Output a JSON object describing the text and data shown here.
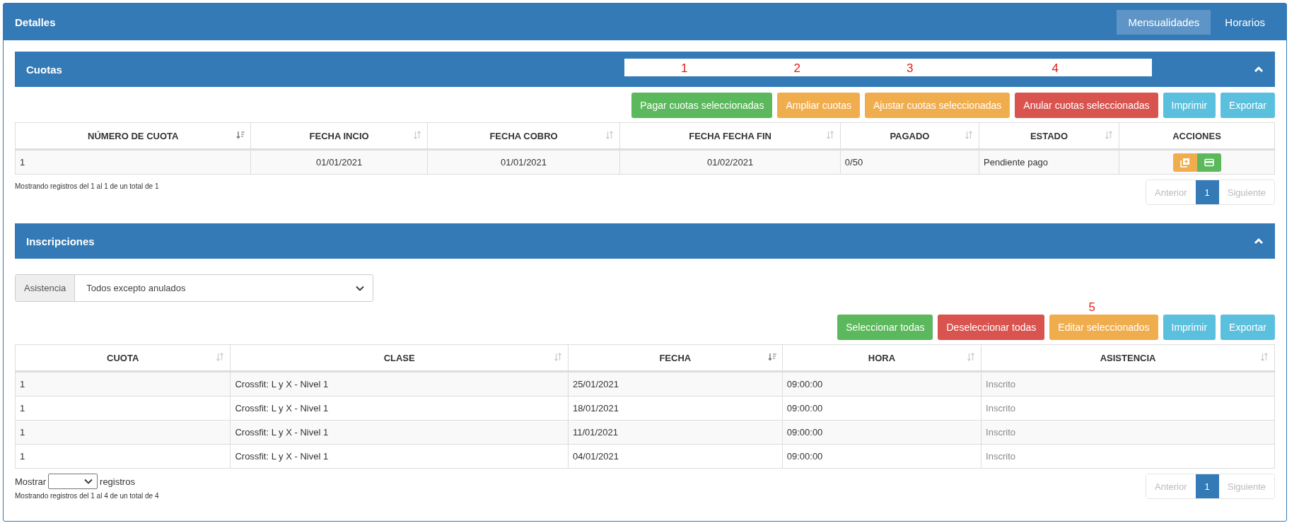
{
  "panel": {
    "title": "Detalles",
    "tabs": [
      {
        "label": "Mensualidades",
        "selected": true
      },
      {
        "label": "Horarios",
        "selected": false
      }
    ]
  },
  "cuotas": {
    "title": "Cuotas",
    "annotations": [
      "1",
      "2",
      "3",
      "4"
    ],
    "buttons": [
      {
        "label": "Pagar cuotas seleccionadas",
        "kind": "success"
      },
      {
        "label": "Ampliar cuotas",
        "kind": "warning"
      },
      {
        "label": "Ajustar cuotas seleccionadas",
        "kind": "warning"
      },
      {
        "label": "Anular cuotas seleccionadas",
        "kind": "danger"
      },
      {
        "label": "Imprimir",
        "kind": "info"
      },
      {
        "label": "Exportar",
        "kind": "info"
      }
    ],
    "columns": [
      {
        "label": "NÚMERO DE CUOTA",
        "sorted": true
      },
      {
        "label": "FECHA INCIO",
        "sorted": false
      },
      {
        "label": "FECHA COBRO",
        "sorted": false
      },
      {
        "label": "FECHA FECHA FIN",
        "sorted": false
      },
      {
        "label": "PAGADO",
        "sorted": false
      },
      {
        "label": "ESTADO",
        "sorted": false
      },
      {
        "label": "ACCIONES"
      }
    ],
    "rows": [
      {
        "cells": [
          "1",
          "01/01/2021",
          "01/01/2021",
          "01/02/2021",
          "0/50",
          "Pendiente pago"
        ],
        "actions": [
          {
            "kind": "add"
          },
          {
            "kind": "pay"
          }
        ]
      }
    ],
    "info": "Mostrando registros del 1 al 1 de un total de 1",
    "pagination": [
      {
        "label": "Anterior",
        "disabled": true,
        "selected": false
      },
      {
        "label": "1",
        "disabled": false,
        "selected": true
      },
      {
        "label": "Siguiente",
        "disabled": true,
        "selected": false
      }
    ]
  },
  "inscripciones": {
    "title": "Inscripciones",
    "filter": {
      "label": "Asistencia",
      "value": "Todos excepto anulados"
    },
    "annotation": "5",
    "buttons": [
      {
        "label": "Seleccionar todas",
        "kind": "success"
      },
      {
        "label": "Deseleccionar todas",
        "kind": "danger"
      },
      {
        "label": "Editar seleccionados",
        "kind": "warning"
      },
      {
        "label": "Imprimir",
        "kind": "info"
      },
      {
        "label": "Exportar",
        "kind": "info"
      }
    ],
    "columns": [
      {
        "label": "CUOTA",
        "sorted": false
      },
      {
        "label": "CLASE",
        "sorted": false
      },
      {
        "label": "FECHA",
        "sorted": true
      },
      {
        "label": "HORA",
        "sorted": false
      },
      {
        "label": "ASISTENCIA",
        "sorted": false
      }
    ],
    "rows": [
      {
        "cells": [
          "1",
          "Crossfit: L y X - Nivel 1",
          "25/01/2021",
          "09:00:00",
          "Inscrito"
        ]
      },
      {
        "cells": [
          "1",
          "Crossfit: L y X - Nivel 1",
          "18/01/2021",
          "09:00:00",
          "Inscrito"
        ]
      },
      {
        "cells": [
          "1",
          "Crossfit: L y X - Nivel 1",
          "11/01/2021",
          "09:00:00",
          "Inscrito"
        ]
      },
      {
        "cells": [
          "1",
          "Crossfit: L y X - Nivel 1",
          "04/01/2021",
          "09:00:00",
          "Inscrito"
        ]
      }
    ],
    "length": {
      "before": "Mostrar",
      "after": "registros"
    },
    "info": "Mostrando registros del 1 al 4 de un total de 4",
    "pagination": [
      {
        "label": "Anterior",
        "disabled": true,
        "selected": false
      },
      {
        "label": "1",
        "disabled": false,
        "selected": true
      },
      {
        "label": "Siguiente",
        "disabled": true,
        "selected": false
      }
    ]
  }
}
